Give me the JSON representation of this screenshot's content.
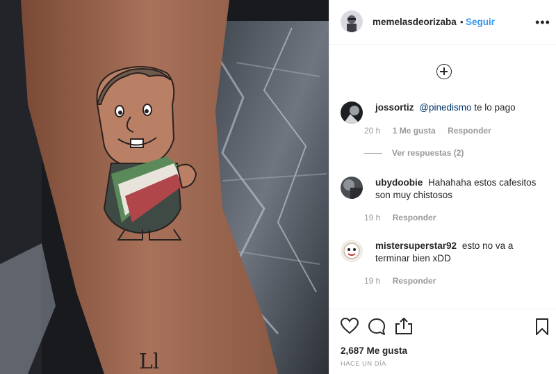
{
  "post": {
    "username": "memelasdeorizaba",
    "separator": "•",
    "follow_label": "Seguir",
    "more_label": "•••"
  },
  "comments": [
    {
      "username": "jossortiz",
      "mention": "@pinedismo",
      "text": " te lo pago",
      "time": "20 h",
      "likes": "1 Me gusta",
      "reply": "Responder",
      "view_replies": "Ver respuestas (2)"
    },
    {
      "username": "ubydoobie",
      "text": "Hahahaha estos cafesitos son muy chistosos",
      "time": "19 h",
      "reply": "Responder"
    },
    {
      "username": "mistersuperstar92",
      "text": "esto no va a terminar bien xDD",
      "time": "19 h",
      "reply": "Responder"
    }
  ],
  "footer": {
    "likes": "2,687 Me gusta",
    "time": "HACE UN DÍA"
  },
  "icons": {
    "like": "heart-icon",
    "comment": "comment-bubble-icon",
    "share": "share-icon",
    "save": "bookmark-icon",
    "load": "plus-circle-icon"
  }
}
